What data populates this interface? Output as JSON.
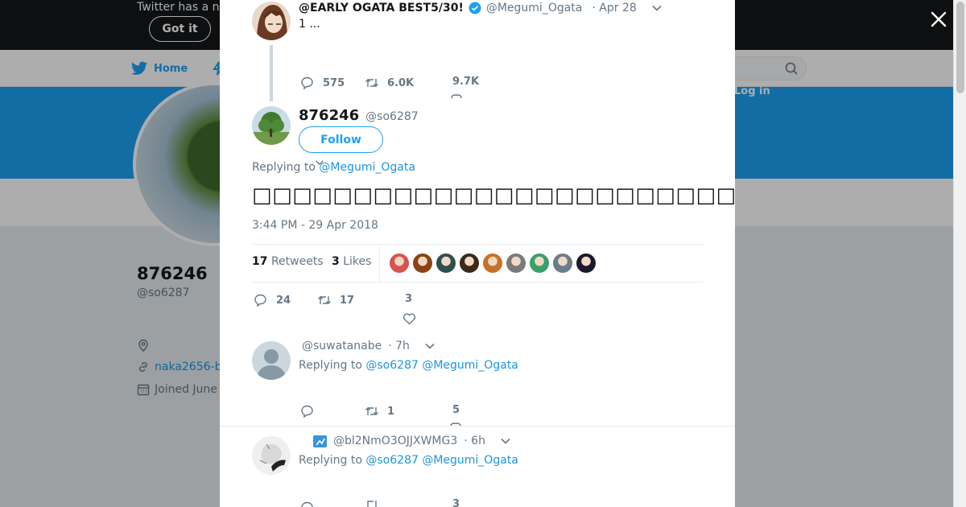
{
  "background": {
    "cookie_text": "Twitter has a n",
    "cookie_button": "Got it",
    "nav_home": "Home",
    "login": "Log in",
    "profile_name": "876246",
    "profile_handle": "@so6287",
    "profile_link": "naka2656-b",
    "profile_joined": "Joined June"
  },
  "parent_tweet": {
    "name": "@EARLY OGATA BEST5/30!",
    "handle": "@Megumi_Ogata",
    "time": "· Apr 28",
    "text": "1 ...",
    "replies": "575",
    "retweets": "6.0K",
    "likes": "9.7K"
  },
  "main_tweet": {
    "name": "876246",
    "handle": "@so6287",
    "follow_label": "Follow",
    "replying_prefix": "Replying to",
    "replying_to": "@Megumi_Ogata",
    "text": "□□□□□□□□□□□□□□□□□□□□□□□□□□F□□□□□□□□□□□□□□□□□□□□□□□□□□□□□□□□□□□□",
    "timestamp": "3:44 PM - 29 Apr 2018",
    "retweet_count": "17",
    "retweet_label": "Retweets",
    "like_count": "3",
    "like_label": "Likes",
    "replies": "24",
    "retweets": "17",
    "likes": "3",
    "liker_colors": [
      "#d9534f",
      "#8b4513",
      "#2f4f4f",
      "#3b2a1a",
      "#c8702a",
      "#7a7a7a",
      "#38a169",
      "#6b7c8a",
      "#1a1a2e"
    ]
  },
  "replies": [
    {
      "handle": "@suwatanabe",
      "time": "· 7h",
      "replying_prefix": "Replying to",
      "replying_to": "@so6287 @Megumi_Ogata",
      "replies": "",
      "retweets": "1",
      "likes": "5"
    },
    {
      "handle": "@bl2NmO3OJJXWMG3",
      "time": "· 6h",
      "replying_prefix": "Replying to",
      "replying_to": "@so6287 @Megumi_Ogata",
      "replies": "",
      "retweets": "",
      "likes": "3"
    }
  ],
  "colors": {
    "accent": "#1da1f2",
    "link": "#1b95e0",
    "muted": "#657786"
  }
}
